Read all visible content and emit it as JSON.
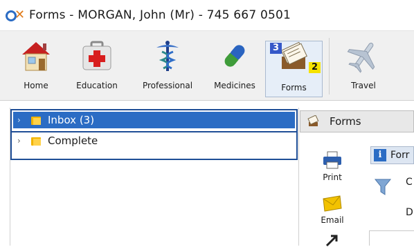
{
  "window": {
    "title": "Forms  -  MORGAN, John (Mr) - 745 667 0501",
    "logo_icon": "app-logo-icon"
  },
  "toolbar": {
    "items": [
      {
        "label": "Home",
        "icon": "home-icon"
      },
      {
        "label": "Education",
        "icon": "medical-kit-icon"
      },
      {
        "label": "Professional",
        "icon": "caduceus-icon"
      },
      {
        "label": "Medicines",
        "icon": "capsule-icon"
      },
      {
        "label": "Forms",
        "icon": "card-file-icon",
        "key_badge": "3",
        "count_badge": "2",
        "active": true
      },
      {
        "label": "Travel",
        "icon": "airplane-icon"
      }
    ]
  },
  "tree": {
    "items": [
      {
        "label": "Inbox (3)",
        "selected": true
      },
      {
        "label": "Complete",
        "selected": false
      }
    ]
  },
  "right_panel": {
    "header_label": "Forms",
    "actions": [
      {
        "label": "Print",
        "icon": "printer-icon"
      },
      {
        "label": "Email",
        "icon": "envelope-icon"
      }
    ],
    "info_tab_label": "Forr",
    "info_letters": [
      "C",
      "D"
    ]
  },
  "colors": {
    "accent": "#2b6cc4",
    "border_dark": "#1f4e96",
    "badge_blue": "#3558c8",
    "badge_yellow": "#f5e200"
  }
}
